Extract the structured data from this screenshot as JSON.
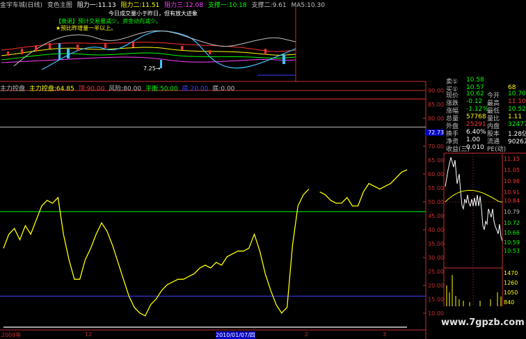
{
  "topbar": {
    "items": [
      {
        "text": "金宇车城(日线)",
        "color": "#c0c0c0"
      },
      {
        "text": "变色主图",
        "color": "#c0c0c0"
      },
      {
        "text": "阻力一:11.13",
        "color": "#ffffff"
      },
      {
        "text": "阻力二:11.51",
        "color": "#ffff00"
      },
      {
        "text": "阻力三:12.08",
        "color": "#ff40ff"
      },
      {
        "text": "支撑一:10.18",
        "color": "#00ff00"
      },
      {
        "text": "支撑二:9.61",
        "color": "#c0c0c0"
      },
      {
        "text": "MA5:10.30",
        "color": "#c0c0c0"
      }
    ]
  },
  "annotations": {
    "line1": "今日成交量小于昨日，但有放大迹象",
    "line2": "【衰退】预计交易量减少。资金动向减少。",
    "line3": "★预比昨增量一半以上。",
    "price_mark": "7.25→"
  },
  "indicator": {
    "name": "主力控盘",
    "items": [
      {
        "text": "主力控盘:64.85",
        "color": "#ffff00"
      },
      {
        "text": "顶:90.00",
        "color": "#ff3030"
      },
      {
        "text": "风险:80.00",
        "color": "#c0c0c0"
      },
      {
        "text": "平衡:50.00",
        "color": "#00ff00"
      },
      {
        "text": "底:20.00",
        "color": "#4040ff"
      },
      {
        "text": "底:0.00",
        "color": "#c0c0c0"
      }
    ],
    "cursor_value": "72.73"
  },
  "axis_ticks": [
    "90.00",
    "85.00",
    "80.00",
    "75.00",
    "70.00",
    "65.00",
    "60.00",
    "55.00",
    "50.00",
    "45.00",
    "40.00",
    "35.00",
    "30.00",
    "25.00",
    "20.00",
    "15.00",
    "10.00"
  ],
  "dates": {
    "d1": "2009年",
    "d2": "12",
    "d3": "2010/01/07/四",
    "d4": "2",
    "d5": "3"
  },
  "quote": {
    "rows": [
      {
        "l1": "卖①",
        "v1": "10.58",
        "c1": "#00ff00",
        "l2": "",
        "v2": "",
        "c2": "#ffff00"
      },
      {
        "l1": "买①",
        "v1": "10.57",
        "c1": "#00ff00",
        "l2": "",
        "v2": "68",
        "c2": "#ffff00"
      },
      {
        "l1": "现价",
        "v1": "10.62",
        "c1": "#00ff00",
        "l2": "今开",
        "v2": "10.70",
        "c2": "#00ff00"
      },
      {
        "l1": "涨跌",
        "v1": "-0.12",
        "c1": "#00ff00",
        "l2": "最高",
        "v2": "11.10",
        "c2": "#ff3030"
      },
      {
        "l1": "涨幅",
        "v1": "-1.12%",
        "c1": "#00ff00",
        "l2": "最低",
        "v2": "10.52",
        "c2": "#00ff00"
      },
      {
        "l1": "总量",
        "v1": "57768",
        "c1": "#ffff00",
        "l2": "量比",
        "v2": "1.11",
        "c2": "#ffff00"
      },
      {
        "l1": "外盘",
        "v1": "25291",
        "c1": "#ff3030",
        "l2": "内盘",
        "v2": "32477",
        "c2": "#00ff00"
      },
      {
        "l1": "换手",
        "v1": "6.40%",
        "c1": "#ffffff",
        "l2": "股本",
        "v2": "1.28亿",
        "c2": "#ffffff"
      },
      {
        "l1": "净资",
        "v1": "1.00",
        "c1": "#ffffff",
        "l2": "流通",
        "v2": "9026万",
        "c2": "#ffffff"
      },
      {
        "l1": "收益(三)",
        "v1": "0.010",
        "c1": "#ffffff",
        "l2": "PE(动)",
        "v2": "",
        "c2": "#ffffff"
      }
    ]
  },
  "mini_price_axis": [
    "11.15",
    "11.05",
    "10.98",
    "10.91",
    "10.84",
    "10.79",
    "10.72",
    "10.66",
    "10.59",
    "10.53"
  ],
  "mini_vol_axis": [
    "1470",
    "1260",
    "1050",
    "840"
  ],
  "watermark": "www.7gpzb.com",
  "chart_data": {
    "type": "line",
    "title": "",
    "series": [
      {
        "name": "主力控盘",
        "values": [
          37,
          42,
          44,
          40,
          45,
          42,
          47,
          52,
          54,
          53,
          55,
          42,
          33,
          26,
          26,
          33,
          37,
          42,
          46,
          43,
          38,
          32,
          26,
          20,
          16,
          14,
          13,
          17,
          19,
          22,
          24,
          25,
          26,
          26,
          27,
          28,
          30,
          31,
          30,
          32,
          31,
          34,
          35,
          36,
          36,
          37,
          42,
          36,
          28,
          22,
          17,
          14,
          16,
          38,
          52,
          56,
          58,
          null,
          57,
          56,
          54,
          53,
          53,
          55,
          52,
          52,
          57,
          60,
          59,
          58,
          59,
          60,
          62,
          64,
          64.85
        ]
      }
    ],
    "reference_lines": [
      {
        "name": "顶",
        "value": 90,
        "color": "#ff3030"
      },
      {
        "name": "风险",
        "value": 80,
        "color": "#c0c0c0"
      },
      {
        "name": "平衡",
        "value": 50,
        "color": "#00ff00"
      },
      {
        "name": "底",
        "value": 20,
        "color": "#4040ff"
      }
    ],
    "ylim": [
      8,
      93
    ]
  }
}
